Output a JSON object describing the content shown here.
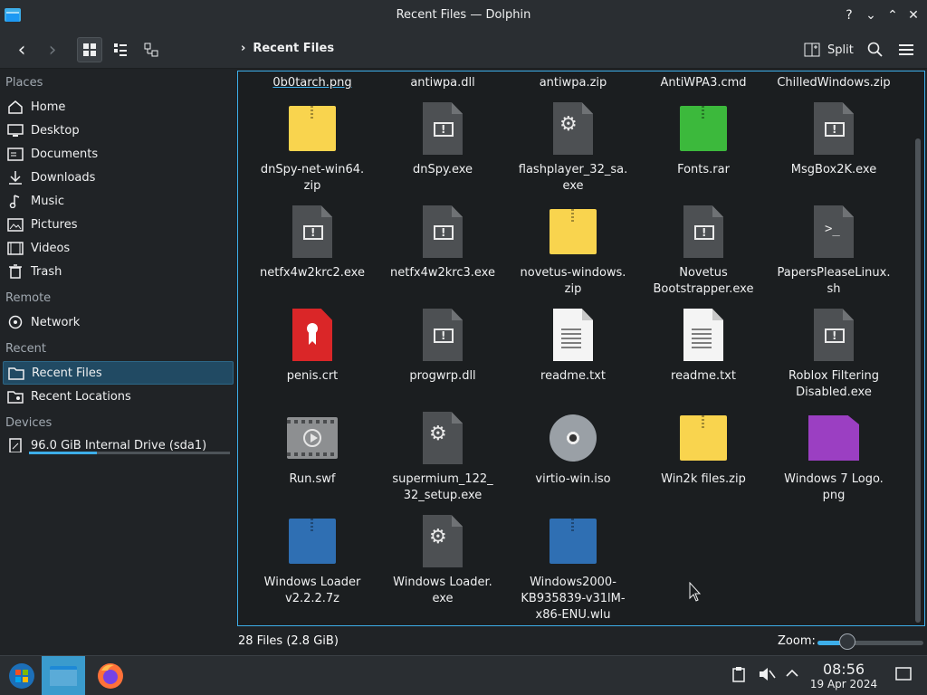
{
  "window": {
    "title": "Recent Files — Dolphin",
    "app_icon": "folder-icon",
    "help_glyph": "?",
    "minimize_glyph": "⌄",
    "maximize_glyph": "⌃",
    "close_glyph": "✕"
  },
  "toolbar": {
    "back_glyph": "‹",
    "forward_glyph": "›",
    "breadcrumb_chevron": "›",
    "breadcrumb": "Recent Files",
    "split_label": "Split",
    "view_modes": [
      "icons",
      "compact",
      "details"
    ],
    "active_view": "icons"
  },
  "sidebar": {
    "sections": [
      {
        "title": "Places",
        "items": [
          {
            "label": "Home",
            "icon": "home-icon"
          },
          {
            "label": "Desktop",
            "icon": "desktop-icon"
          },
          {
            "label": "Documents",
            "icon": "documents-icon"
          },
          {
            "label": "Downloads",
            "icon": "downloads-icon"
          },
          {
            "label": "Music",
            "icon": "music-icon"
          },
          {
            "label": "Pictures",
            "icon": "pictures-icon"
          },
          {
            "label": "Videos",
            "icon": "videos-icon"
          },
          {
            "label": "Trash",
            "icon": "trash-icon"
          }
        ]
      },
      {
        "title": "Remote",
        "items": [
          {
            "label": "Network",
            "icon": "network-icon"
          }
        ]
      },
      {
        "title": "Recent",
        "items": [
          {
            "label": "Recent Files",
            "icon": "recent-files-icon",
            "selected": true
          },
          {
            "label": "Recent Locations",
            "icon": "recent-locations-icon"
          }
        ]
      },
      {
        "title": "Devices",
        "items": [
          {
            "label": "96.0 GiB Internal Drive (sda1)",
            "icon": "drive-icon",
            "usage_fraction": 0.34
          }
        ]
      }
    ]
  },
  "files": {
    "partial_row": [
      "0b0tarch.png",
      "antiwpa.dll",
      "antiwpa.zip",
      "AntiWPA3.cmd",
      "ChilledWindows.zip"
    ],
    "items": [
      {
        "name": "dnSpy-net-win64.\nzip",
        "type": "zip-yellow"
      },
      {
        "name": "dnSpy.exe",
        "type": "exe"
      },
      {
        "name": "flashplayer_32_sa.\nexe",
        "type": "exe-gear"
      },
      {
        "name": "Fonts.rar",
        "type": "zip-green"
      },
      {
        "name": "MsgBox2K.exe",
        "type": "exe"
      },
      {
        "name": "netfx4w2krc2.exe",
        "type": "exe"
      },
      {
        "name": "netfx4w2krc3.exe",
        "type": "exe"
      },
      {
        "name": "novetus-windows.\nzip",
        "type": "zip-yellow"
      },
      {
        "name": "Novetus\nBootstrapper.exe",
        "type": "exe"
      },
      {
        "name": "PapersPleaseLinux.\nsh",
        "type": "script"
      },
      {
        "name": "penis.crt",
        "type": "cert"
      },
      {
        "name": "progwrp.dll",
        "type": "exe"
      },
      {
        "name": "readme.txt",
        "type": "text"
      },
      {
        "name": "readme.txt",
        "type": "text"
      },
      {
        "name": "Roblox Filtering\nDisabled.exe",
        "type": "exe"
      },
      {
        "name": "Run.swf",
        "type": "video"
      },
      {
        "name": "supermium_122_\n32_setup.exe",
        "type": "exe-gear"
      },
      {
        "name": "virtio-win.iso",
        "type": "disc"
      },
      {
        "name": "Win2k files.zip",
        "type": "zip-yellow"
      },
      {
        "name": "Windows 7 Logo.\npng",
        "type": "image"
      },
      {
        "name": "Windows Loader\nv2.2.2.7z",
        "type": "zip-blue"
      },
      {
        "name": "Windows Loader.\nexe",
        "type": "exe-gear"
      },
      {
        "name": "Windows2000-\nKB935839-v31lM-\nx86-ENU.wlu",
        "type": "zip-blue"
      }
    ]
  },
  "statusbar": {
    "summary": "28 Files (2.8 GiB)",
    "zoom_label": "Zoom:",
    "zoom_level": 0.28
  },
  "taskbar": {
    "apps": [
      "start-menu-icon",
      "dolphin-icon",
      "firefox-icon"
    ],
    "time": "08:56",
    "date": "19 Apr 2024"
  },
  "colors": {
    "accent": "#3daee9",
    "zip_yellow": "#f9d44e",
    "zip_green": "#3cb93c",
    "zip_blue": "#2f6fb3",
    "cert_red": "#da2628",
    "image_purple": "#9b3fc2"
  }
}
